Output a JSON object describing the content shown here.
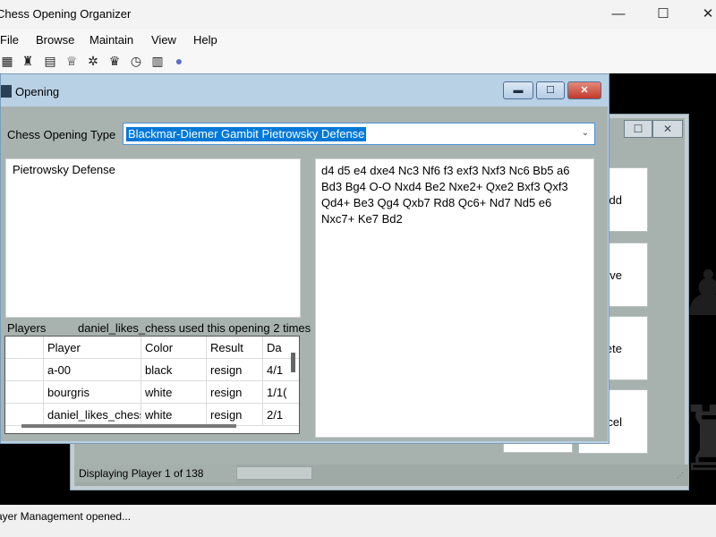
{
  "app": {
    "title": "Chess Opening Organizer",
    "window_controls": {
      "minimize": "—",
      "maximize": "☐",
      "close": "✕"
    }
  },
  "menu": [
    "File",
    "Browse",
    "Maintain",
    "View",
    "Help"
  ],
  "toolbar": {
    "icons": [
      "chessboard-icon",
      "rook-icon",
      "notation-icon",
      "trophy-icon",
      "bug-icon",
      "queen-icon",
      "clock-icon",
      "database-icon",
      "globe-icon"
    ]
  },
  "player_window": {
    "buttons": [
      "dd",
      "ave",
      "elete",
      "ncel"
    ],
    "status": "Displaying Player 1 of 138"
  },
  "opening_window": {
    "title": "Opening",
    "type_label": "Chess Opening Type",
    "type_value": "Blackmar-Diemer Gambit  Pietrowsky Defense",
    "description": "Pietrowsky Defense",
    "moves": "d4 d5 e4 dxe4 Nc3 Nf6 f3 exf3 Nxf3 Nc6 Bb5 a6 Bd3 Bg4 O-O Nxd4 Be2 Nxe2+ Qxe2 Bxf3 Qxf3 Qd4+ Be3 Qg4 Qxb7 Rd8 Qc6+ Nd7 Nd5 e6 Nxc7+ Ke7 Bd2",
    "players_label": "Players",
    "usage_text": "daniel_likes_chess used this opening 2 times",
    "grid": {
      "columns": [
        "",
        "Player",
        "Color",
        "Result",
        "Da"
      ],
      "rows": [
        [
          "",
          "a-00",
          "black",
          "resign",
          "4/1"
        ],
        [
          "",
          "bourgris",
          "white",
          "resign",
          "1/1("
        ],
        [
          "",
          "daniel_likes_chess",
          "white",
          "resign",
          "2/1"
        ]
      ]
    }
  },
  "status_bar": "ayer Management opened..."
}
